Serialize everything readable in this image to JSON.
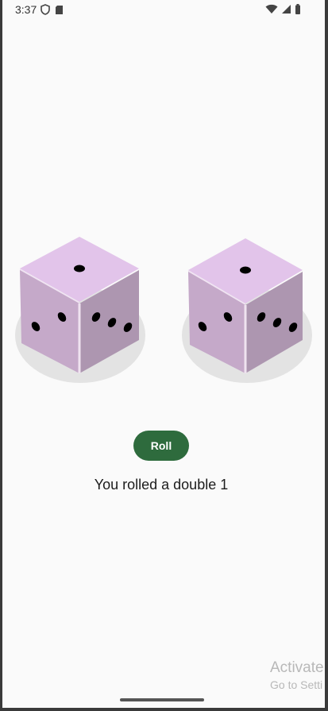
{
  "status_bar": {
    "time": "3:37",
    "left_icons": [
      "shield-icon",
      "sd-card-icon"
    ],
    "right_icons": [
      "wifi-icon",
      "signal-icon",
      "battery-icon"
    ]
  },
  "dice": [
    {
      "name": "left-die",
      "value": 1,
      "color": "#d9bfe0"
    },
    {
      "name": "right-die",
      "value": 1,
      "color": "#d9bfe0"
    }
  ],
  "roll_button": {
    "label": "Roll",
    "color": "#2e6b3d"
  },
  "result": {
    "text": "You rolled a double 1"
  },
  "watermark": {
    "line1": "Activate",
    "line2": "Go to Setti"
  }
}
